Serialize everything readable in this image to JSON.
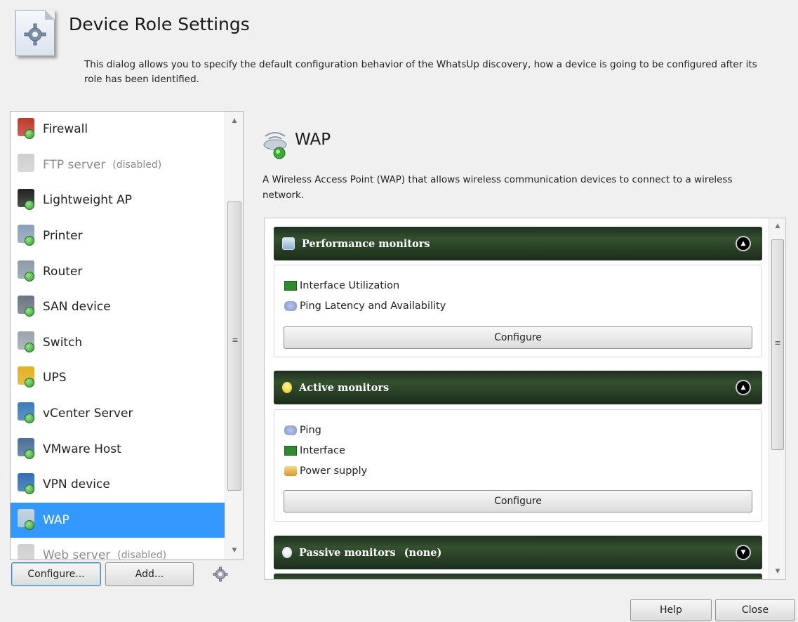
{
  "header": {
    "title": "Device Role Settings",
    "description": "This dialog allows you to specify the default configuration behavior of the WhatsUp discovery, how a device is going to be configured after its role has been identified."
  },
  "roles": [
    {
      "label": "Firewall",
      "note": "",
      "icon": "firewall-icon",
      "color": "#c0392b",
      "state": "normal"
    },
    {
      "label": "FTP server",
      "note": "(disabled)",
      "icon": "ftp-server-icon",
      "color": "#cfcfcf",
      "state": "disabled"
    },
    {
      "label": "Lightweight AP",
      "note": "",
      "icon": "lightweight-ap-icon",
      "color": "#222222",
      "state": "normal"
    },
    {
      "label": "Printer",
      "note": "",
      "icon": "printer-icon",
      "color": "#8aa0b8",
      "state": "normal"
    },
    {
      "label": "Router",
      "note": "",
      "icon": "router-icon",
      "color": "#8c9aa8",
      "state": "normal"
    },
    {
      "label": "SAN device",
      "note": "",
      "icon": "san-device-icon",
      "color": "#6b7480",
      "state": "normal"
    },
    {
      "label": "Switch",
      "note": "",
      "icon": "switch-icon",
      "color": "#9aa4ae",
      "state": "normal"
    },
    {
      "label": "UPS",
      "note": "",
      "icon": "ups-icon",
      "color": "#e0b020",
      "state": "normal"
    },
    {
      "label": "vCenter Server",
      "note": "",
      "icon": "vcenter-server-icon",
      "color": "#3a7ab8",
      "state": "normal"
    },
    {
      "label": "VMware Host",
      "note": "",
      "icon": "vmware-host-icon",
      "color": "#4a6e9a",
      "state": "normal"
    },
    {
      "label": "VPN device",
      "note": "",
      "icon": "vpn-device-icon",
      "color": "#2f6fb4",
      "state": "normal"
    },
    {
      "label": "WAP",
      "note": "",
      "icon": "wap-icon",
      "color": "#c9d3dc",
      "state": "selected"
    },
    {
      "label": "Web server",
      "note": "(disabled)",
      "icon": "web-server-icon",
      "color": "#cfcfcf",
      "state": "disabled"
    }
  ],
  "list_buttons": {
    "configure": "Configure...",
    "add": "Add..."
  },
  "detail": {
    "title": "WAP",
    "description": "A Wireless Access Point (WAP) that allows wireless communication devices to connect to a wireless network."
  },
  "sections": {
    "performance": {
      "title": "Performance monitors",
      "icon": "chart-icon",
      "items": [
        {
          "label": "Interface Utilization",
          "icon": "interface-icon"
        },
        {
          "label": "Ping Latency and Availability",
          "icon": "ping-icon"
        }
      ],
      "configure_label": "Configure"
    },
    "active": {
      "title": "Active monitors",
      "icon": "lightbulb-icon",
      "items": [
        {
          "label": "Ping",
          "icon": "ping-icon"
        },
        {
          "label": "Interface",
          "icon": "interface-icon"
        },
        {
          "label": "Power supply",
          "icon": "power-supply-icon"
        }
      ],
      "configure_label": "Configure"
    },
    "passive": {
      "title": "Passive monitors",
      "note": "(none)",
      "icon": "passive-bulb-icon"
    }
  },
  "dialog_buttons": {
    "help": "Help",
    "close": "Close"
  },
  "colors": {
    "selection": "#3399ff",
    "section_header": "#2a3f28",
    "badge": "#3ea83a"
  }
}
